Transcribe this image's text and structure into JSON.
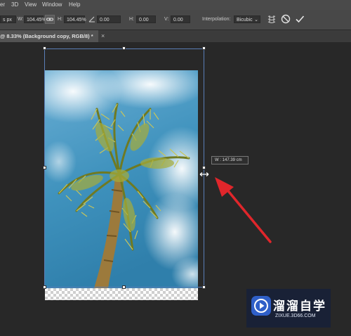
{
  "menubar": {
    "items": [
      "er",
      "3D",
      "View",
      "Window",
      "Help"
    ]
  },
  "options": {
    "x_value": "s px",
    "w_label": "W:",
    "w_value": "104.45%",
    "h_label": "H:",
    "h_value": "104.45%",
    "angle_value": "0.00",
    "h_skew_label": "H:",
    "h_skew_value": "0.00",
    "v_skew_label": "V:",
    "v_skew_value": "0.00",
    "interpolation_label": "Interpolation:",
    "interpolation_value": "Bicubic"
  },
  "document_tab": {
    "title": "@ 8.33% (Background copy, RGB/8) *",
    "close": "×"
  },
  "transform_tooltip": {
    "text": "W :  147.39 cm"
  },
  "watermark": {
    "text": "溜溜自学",
    "url": "ZIXUE.3D66.COM"
  },
  "colors": {
    "annotation_arrow": "#e0262b",
    "bounding_box": "#5a7fb8",
    "sky": "#3f92bd"
  },
  "icons": [
    "link-icon",
    "angle-icon",
    "warp-icon",
    "cancel-icon",
    "commit-check-icon",
    "scale-cursor-icon",
    "play-icon"
  ]
}
